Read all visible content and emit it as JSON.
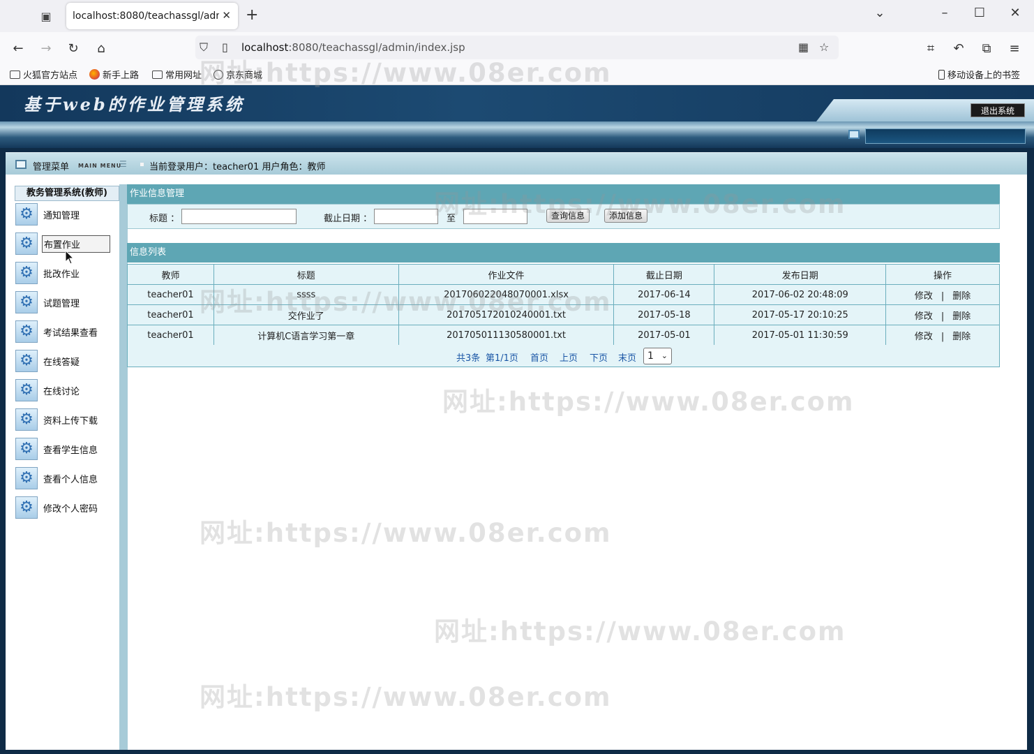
{
  "browser": {
    "tab_title": "localhost:8080/teachassgl/admin",
    "url_host": "localhost",
    "url_rest": ":8080/teachassgl/admin/index.jsp",
    "bookmarks": [
      "火狐官方站点",
      "新手上路",
      "常用网址",
      "京东商城"
    ],
    "mobile_bookmarks": "移动设备上的书签"
  },
  "header": {
    "logo": "基于web的作业管理系统",
    "logout": "退出系统"
  },
  "menubar": {
    "title": "管理菜单",
    "subtitle": "MAIN MENU",
    "user_info": "当前登录用户：teacher01  用户角色：教师"
  },
  "sidebar": {
    "title": "教务管理系统(教师)",
    "items": [
      "通知管理",
      "布置作业",
      "批改作业",
      "试题管理",
      "考试结果查看",
      "在线答疑",
      "在线讨论",
      "资料上传下载",
      "查看学生信息",
      "查看个人信息",
      "修改个人密码"
    ]
  },
  "search": {
    "panel_title": "作业信息管理",
    "title_label": "标题 ：",
    "date_label": "截止日期 ：",
    "to_label": "至",
    "query_btn": "查询信息",
    "add_btn": "添加信息"
  },
  "list": {
    "panel_title": "信息列表",
    "headers": [
      "教师",
      "标题",
      "作业文件",
      "截止日期",
      "发布日期",
      "操作"
    ],
    "rows": [
      [
        "teacher01",
        "ssss",
        "20170602204807000​1.xlsx",
        "2017-06-14",
        "2017-06-02 20:48:09"
      ],
      [
        "teacher01",
        "交作业了",
        "201705172010240001.txt",
        "2017-05-18",
        "2017-05-17 20:10:25"
      ],
      [
        "teacher01",
        "计算机C语言学习第一章",
        "201705011130580001.txt",
        "2017-05-01",
        "2017-05-01 11:30:59"
      ]
    ],
    "edit": "修改",
    "sep": "|",
    "delete": "删除"
  },
  "pager": {
    "total": "共3条",
    "page": "第1/1页",
    "first": "首页",
    "prev": "上页",
    "next": "下页",
    "last": "末页",
    "selected": "1"
  },
  "watermark": "网址:https://www.08er.com"
}
